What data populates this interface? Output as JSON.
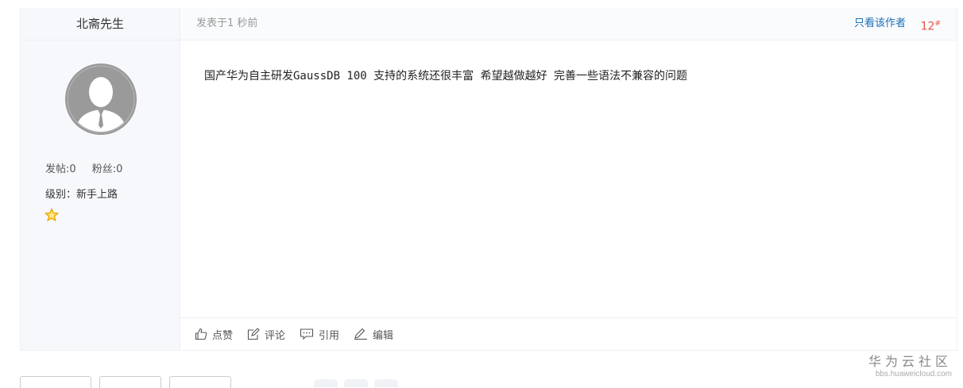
{
  "user": {
    "name": "北斋先生",
    "posts_label": "发帖:0",
    "fans_label": "粉丝:0",
    "level_label": "级别：新手上路",
    "level_icon": "star-icon"
  },
  "post": {
    "time": "发表于1 秒前",
    "author_only": "只看该作者",
    "floor_number": "12",
    "floor_mark": "#",
    "content": "国产华为自主研发GaussDB 100 支持的系统还很丰富 希望越做越好 完善一些语法不兼容的问题"
  },
  "actions": [
    {
      "label": "点赞",
      "icon": "thumbs-up-icon"
    },
    {
      "label": "评论",
      "icon": "comment-icon"
    },
    {
      "label": "引用",
      "icon": "quote-icon"
    },
    {
      "label": "编辑",
      "icon": "edit-icon"
    }
  ],
  "brand": {
    "name": "华为云社区",
    "url": "bbs.huaweicloud.com"
  },
  "colors": {
    "accent_link": "#1a6fb5",
    "floor": "#e8543e",
    "sidebar_bg": "#f7f8fc"
  }
}
